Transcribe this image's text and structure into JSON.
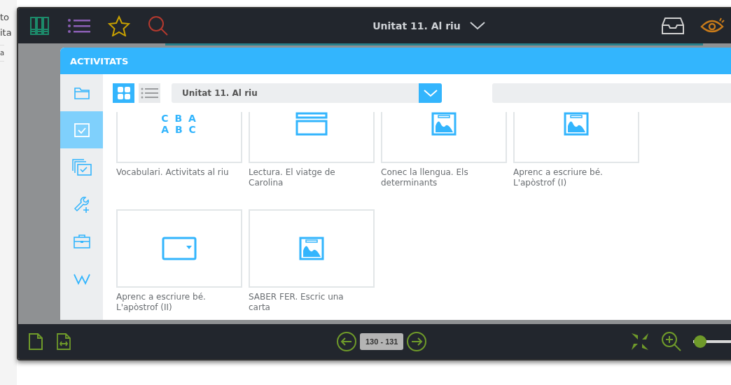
{
  "background_fragments": [
    "to",
    "ita",
    "a"
  ],
  "topbar": {
    "title": "Unitat 11. Al riu"
  },
  "modal": {
    "title": "ACTIVITATS",
    "sidebar": [
      {
        "kind": "folder",
        "selected": false
      },
      {
        "kind": "check",
        "selected": true
      },
      {
        "kind": "multi-check",
        "selected": false
      },
      {
        "kind": "tools",
        "selected": false
      },
      {
        "kind": "briefcase",
        "selected": false
      },
      {
        "kind": "word",
        "selected": false
      }
    ],
    "view_modes": [
      {
        "kind": "grid",
        "selected": true
      },
      {
        "kind": "list",
        "selected": false
      }
    ],
    "unit_select": {
      "value": "Unitat 11. Al riu"
    },
    "activities": [
      {
        "kind": "letters",
        "icon_lines": [
          "C B A",
          "A B C"
        ],
        "title": "Vocabulari. Activitats al riu"
      },
      {
        "kind": "reading",
        "title": "Lectura. El viatge de Carolina"
      },
      {
        "kind": "image",
        "title": "Conec la llengua. Els determinants"
      },
      {
        "kind": "image",
        "title": "Aprenc a escriure bé. L'apòstrof (I)"
      },
      {
        "kind": "dropdown",
        "title": "Aprenc a escriure bé. L'apòstrof (II)"
      },
      {
        "kind": "image",
        "title": "SABER FER. Escric una carta"
      }
    ]
  },
  "pager": {
    "label": "130 - 131"
  },
  "zoom_slider": {
    "level": 0.02
  }
}
